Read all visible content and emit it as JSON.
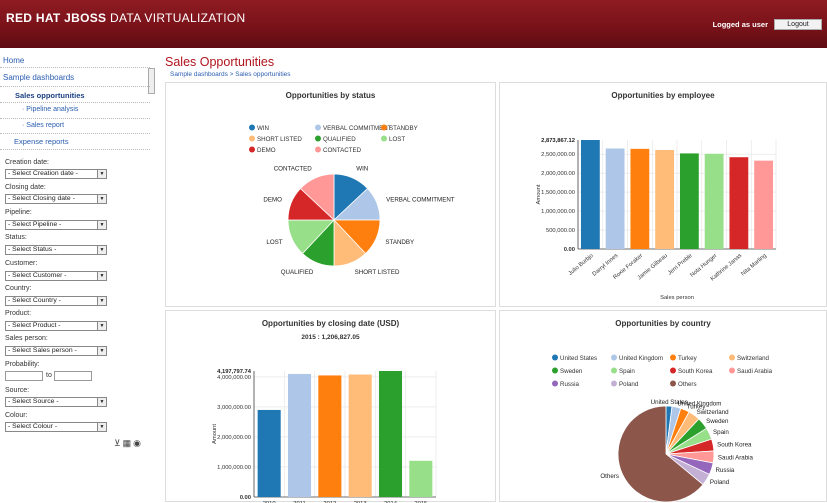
{
  "header": {
    "brand_bold": "RED HAT JBOSS",
    "brand_thin": "DATA VIRTUALIZATION",
    "logged_text": "Logged as user",
    "logout_label": "Logout",
    "colors": {
      "bar": "#7a121a"
    }
  },
  "sidebar": {
    "home": "Home",
    "sample_dashboards": "Sample dashboards",
    "sales_opportunities": "Sales opportunities",
    "pipeline_analysis": "· Pipeline analysis",
    "sales_report": "· Sales report",
    "expense_reports": "Expense reports",
    "filters": {
      "creation_date_label": "Creation date:",
      "creation_date_value": "- Select Creation date -",
      "closing_date_label": "Closing date:",
      "closing_date_value": "- Select Closing date -",
      "pipeline_label": "Pipeline:",
      "pipeline_value": "- Select Pipeline -",
      "status_label": "Status:",
      "status_value": "- Select Status -",
      "customer_label": "Customer:",
      "customer_value": "- Select Customer -",
      "country_label": "Country:",
      "country_value": "- Select Country -",
      "product_label": "Product:",
      "product_value": "- Select Product -",
      "sales_person_label": "Sales person:",
      "sales_person_value": "- Select Sales person -",
      "probability_label": "Probability:",
      "probability_to": "to",
      "source_label": "Source:",
      "source_value": "- Select Source -",
      "colour_label": "Colour:",
      "colour_value": "- Select Colour -"
    }
  },
  "main": {
    "title": "Sales Opportunities",
    "breadcrumb": "Sample dashboards > Sales opportunities"
  },
  "chart_data": [
    {
      "type": "pie",
      "title": "Opportunities by status",
      "legend": [
        "WIN",
        "VERBAL COMMITMENT",
        "STANDBY",
        "SHORT LISTED",
        "QUALIFIED",
        "LOST",
        "DEMO",
        "CONTACTED"
      ],
      "slice_labels": [
        "WIN",
        "VERBAL COMMITMENT",
        "STANDBY",
        "SHORT LISTED",
        "QUALIFIED",
        "LOST",
        "DEMO",
        "CONTACTED"
      ],
      "values": [
        13,
        12,
        13,
        12,
        12,
        13,
        12,
        13
      ],
      "colors": [
        "#1f77b4",
        "#aec7e8",
        "#ff7f0e",
        "#ffbb78",
        "#2ca02c",
        "#98df8a",
        "#d62728",
        "#ff9896"
      ]
    },
    {
      "type": "bar",
      "title": "Opportunities by employee",
      "ylabel": "Amount",
      "xlabel": "Sales person",
      "max_label": "2,873,867.12",
      "yticks": [
        "2,500,000.00",
        "2,000,000.00",
        "1,500,000.00",
        "1,000,000.00",
        "500,000.00",
        "0.00"
      ],
      "categories": [
        "Julio Burbjo",
        "Darryl Innes",
        "Roxie Foraker",
        "Jamie Gilbeau",
        "Jerri Preble",
        "Nota Hunger",
        "Kathrine Janas",
        "Nita Marling"
      ],
      "values": [
        2873867.12,
        2650000,
        2640000,
        2610000,
        2520000,
        2510000,
        2420000,
        2330000
      ],
      "ylim": [
        0,
        2873867.12
      ],
      "colors": [
        "#1f77b4",
        "#aec7e8",
        "#ff7f0e",
        "#ffbb78",
        "#2ca02c",
        "#98df8a",
        "#d62728",
        "#ff9896"
      ]
    },
    {
      "type": "bar",
      "title": "Opportunities by closing date (USD)",
      "subtitle": "2015 : 1,206,827.05",
      "ylabel": "Amount",
      "max_label": "4,197,797.74",
      "yticks": [
        "4,000,000.00",
        "3,000,000.00",
        "2,000,000.00",
        "1,000,000.00",
        "0.00"
      ],
      "categories": [
        "2010",
        "2011",
        "2012",
        "2013",
        "2014",
        "2015"
      ],
      "values": [
        2900000,
        4100000,
        4050000,
        4080000,
        4197797.74,
        1206827.05
      ],
      "ylim": [
        0,
        4197797.74
      ],
      "colors": [
        "#1f77b4",
        "#aec7e8",
        "#ff7f0e",
        "#ffbb78",
        "#2ca02c",
        "#98df8a"
      ]
    },
    {
      "type": "pie",
      "title": "Opportunities by country",
      "legend": [
        "United States",
        "United Kingdom",
        "Turkey",
        "Switzerland",
        "Sweden",
        "Spain",
        "South Korea",
        "Saudi Arabia",
        "Russia",
        "Poland",
        "Others"
      ],
      "slice_labels": [
        "United States",
        "United Kingdom",
        "Turkey",
        "Switzerland",
        "Sweden",
        "Spain",
        "South Korea",
        "Saudi Arabia",
        "Russia",
        "Poland",
        "Others"
      ],
      "values": [
        2,
        3,
        3,
        4,
        4,
        4,
        4,
        4,
        4,
        4,
        64
      ],
      "colors": [
        "#1f77b4",
        "#aec7e8",
        "#ff7f0e",
        "#ffbb78",
        "#2ca02c",
        "#98df8a",
        "#d62728",
        "#ff9896",
        "#9467bd",
        "#c5b0d5",
        "#8c564b"
      ]
    }
  ]
}
